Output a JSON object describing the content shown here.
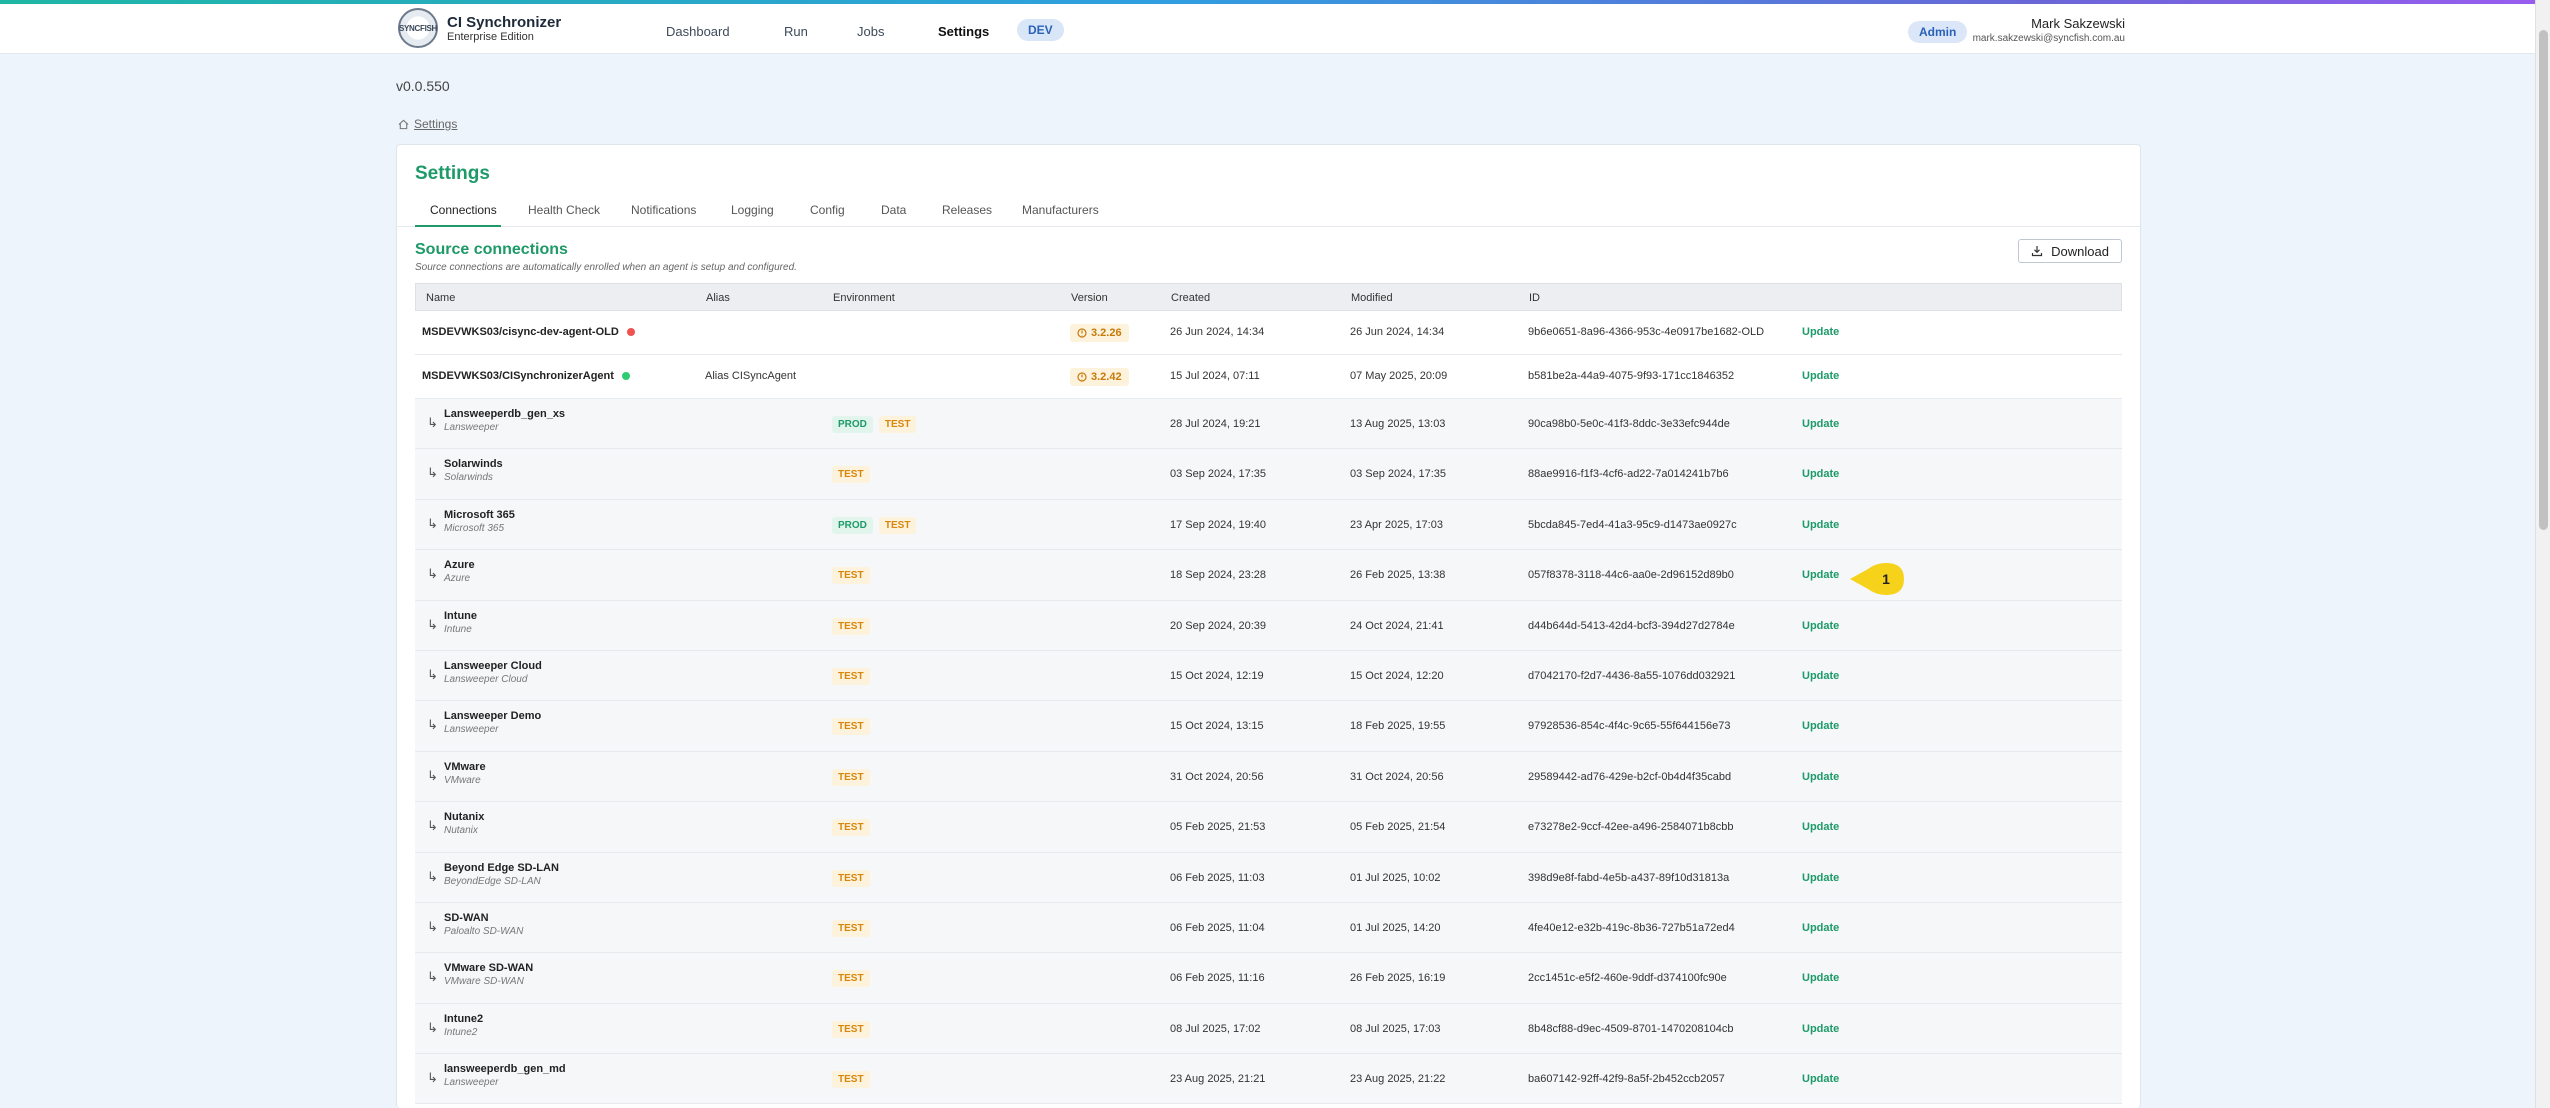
{
  "app": {
    "name": "CI Synchronizer",
    "edition": "Enterprise Edition",
    "logo_text": "SYNCFISH"
  },
  "nav": {
    "dashboard": "Dashboard",
    "run": "Run",
    "jobs": "Jobs",
    "settings": "Settings",
    "env_badge": "DEV"
  },
  "user": {
    "role": "Admin",
    "name": "Mark Sakzewski",
    "email": "mark.sakzewski@syncfish.com.au"
  },
  "version": "v0.0.550",
  "breadcrumb": {
    "label": "Settings"
  },
  "settings": {
    "title": "Settings",
    "tabs": [
      "Connections",
      "Health Check",
      "Notifications",
      "Logging",
      "Config",
      "Data",
      "Releases",
      "Manufacturers"
    ],
    "section_title": "Source connections",
    "section_subtitle": "Source connections are automatically enrolled when an agent is setup and configured.",
    "download_label": "Download"
  },
  "table": {
    "headers": {
      "name": "Name",
      "alias": "Alias",
      "environment": "Environment",
      "version": "Version",
      "created": "Created",
      "modified": "Modified",
      "id": "ID"
    },
    "update_label": "Update",
    "agents": [
      {
        "name": "MSDEVWKS03/cisync-dev-agent-OLD",
        "status_color": "#ef5350",
        "alias": "",
        "version": "3.2.26",
        "created": "26 Jun 2024, 14:34",
        "modified": "26 Jun 2024, 14:34",
        "id": "9b6e0651-8a96-4366-953c-4e0917be1682-OLD"
      },
      {
        "name": "MSDEVWKS03/CISynchronizerAgent",
        "status_color": "#2ecc71",
        "alias": "Alias CISyncAgent",
        "version": "3.2.42",
        "created": "15 Jul 2024, 07:11",
        "modified": "07 May 2025, 20:09",
        "id": "b581be2a-44a9-4075-9f93-171cc1846352"
      }
    ],
    "connections": [
      {
        "name": "Lansweeperdb_gen_xs",
        "type": "Lansweeper",
        "env": [
          "PROD",
          "TEST"
        ],
        "created": "28 Jul 2024, 19:21",
        "modified": "13 Aug 2025, 13:03",
        "id": "90ca98b0-5e0c-41f3-8ddc-3e33efc944de"
      },
      {
        "name": "Solarwinds",
        "type": "Solarwinds",
        "env": [
          "TEST"
        ],
        "created": "03 Sep 2024, 17:35",
        "modified": "03 Sep 2024, 17:35",
        "id": "88ae9916-f1f3-4cf6-ad22-7a014241b7b6"
      },
      {
        "name": "Microsoft 365",
        "type": "Microsoft 365",
        "env": [
          "PROD",
          "TEST"
        ],
        "created": "17 Sep 2024, 19:40",
        "modified": "23 Apr 2025, 17:03",
        "id": "5bcda845-7ed4-41a3-95c9-d1473ae0927c"
      },
      {
        "name": "Azure",
        "type": "Azure",
        "env": [
          "TEST"
        ],
        "created": "18 Sep 2024, 23:28",
        "modified": "26 Feb 2025, 13:38",
        "id": "057f8378-3118-44c6-aa0e-2d96152d89b0"
      },
      {
        "name": "Intune",
        "type": "Intune",
        "env": [
          "TEST"
        ],
        "created": "20 Sep 2024, 20:39",
        "modified": "24 Oct 2024, 21:41",
        "id": "d44b644d-5413-42d4-bcf3-394d27d2784e"
      },
      {
        "name": "Lansweeper Cloud",
        "type": "Lansweeper Cloud",
        "env": [
          "TEST"
        ],
        "created": "15 Oct 2024, 12:19",
        "modified": "15 Oct 2024, 12:20",
        "id": "d7042170-f2d7-4436-8a55-1076dd032921"
      },
      {
        "name": "Lansweeper Demo",
        "type": "Lansweeper",
        "env": [
          "TEST"
        ],
        "created": "15 Oct 2024, 13:15",
        "modified": "18 Feb 2025, 19:55",
        "id": "97928536-854c-4f4c-9c65-55f644156e73"
      },
      {
        "name": "VMware",
        "type": "VMware",
        "env": [
          "TEST"
        ],
        "created": "31 Oct 2024, 20:56",
        "modified": "31 Oct 2024, 20:56",
        "id": "29589442-ad76-429e-b2cf-0b4d4f35cabd"
      },
      {
        "name": "Nutanix",
        "type": "Nutanix",
        "env": [
          "TEST"
        ],
        "created": "05 Feb 2025, 21:53",
        "modified": "05 Feb 2025, 21:54",
        "id": "e73278e2-9ccf-42ee-a496-2584071b8cbb"
      },
      {
        "name": "Beyond Edge SD-LAN",
        "type": "BeyondEdge SD-LAN",
        "env": [
          "TEST"
        ],
        "created": "06 Feb 2025, 11:03",
        "modified": "01 Jul 2025, 10:02",
        "id": "398d9e8f-fabd-4e5b-a437-89f10d31813a"
      },
      {
        "name": "SD-WAN",
        "type": "Paloalto SD-WAN",
        "env": [
          "TEST"
        ],
        "created": "06 Feb 2025, 11:04",
        "modified": "01 Jul 2025, 14:20",
        "id": "4fe40e12-e32b-419c-8b36-727b51a72ed4"
      },
      {
        "name": "VMware SD-WAN",
        "type": "VMware SD-WAN",
        "env": [
          "TEST"
        ],
        "created": "06 Feb 2025, 11:16",
        "modified": "26 Feb 2025, 16:19",
        "id": "2cc1451c-e5f2-460e-9ddf-d374100fc90e"
      },
      {
        "name": "Intune2",
        "type": "Intune2",
        "env": [
          "TEST"
        ],
        "created": "08 Jul 2025, 17:02",
        "modified": "08 Jul 2025, 17:03",
        "id": "8b48cf88-d9ec-4509-8701-1470208104cb"
      },
      {
        "name": "lansweeperdb_gen_md",
        "type": "Lansweeper",
        "env": [
          "TEST"
        ],
        "created": "23 Aug 2025, 21:21",
        "modified": "23 Aug 2025, 21:22",
        "id": "ba607142-92ff-42f9-8a5f-2b452ccb2057"
      }
    ]
  },
  "annotation": {
    "label": "1",
    "color": "#f7d21a"
  }
}
